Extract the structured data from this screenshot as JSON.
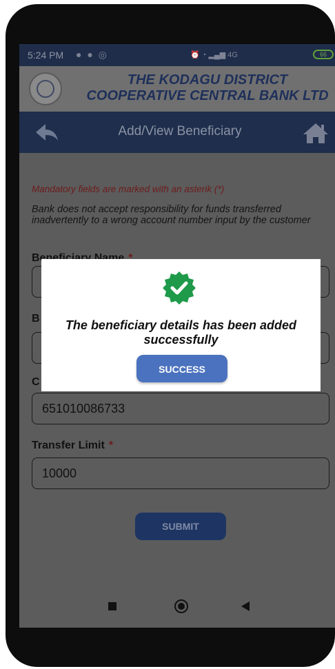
{
  "status_bar": {
    "time": "5:24 PM",
    "network": "4G",
    "battery": "66"
  },
  "bank": {
    "name_line1": "THE KODAGU DISTRICT",
    "name_line2": "COOPERATIVE CENTRAL BANK LTD"
  },
  "nav": {
    "title": "Add/View Beneficiary"
  },
  "form": {
    "mandatory_note": "Mandatory fields are marked with an asterik (*)",
    "disclaimer": "Bank does not accept responsibility for funds transferred inadvertently to a wrong account number input by the customer",
    "beneficiary_name_label": "Beneficiary Name",
    "required_mark": "*",
    "field2_label_partial": "B",
    "field3_label_partial": "C",
    "account_number_value": "651010086733",
    "transfer_limit_label": "Transfer Limit",
    "transfer_limit_value": "10000",
    "submit_label": "SUBMIT"
  },
  "dialog": {
    "message": "The beneficiary details has been added successfully",
    "button_label": "SUCCESS"
  },
  "colors": {
    "header_navy": "#1e2e4c",
    "bank_name": "#1e2f5a",
    "success_green": "#1e9a4a",
    "dialog_button": "#4b72be",
    "required_red": "#6d1b1b"
  }
}
